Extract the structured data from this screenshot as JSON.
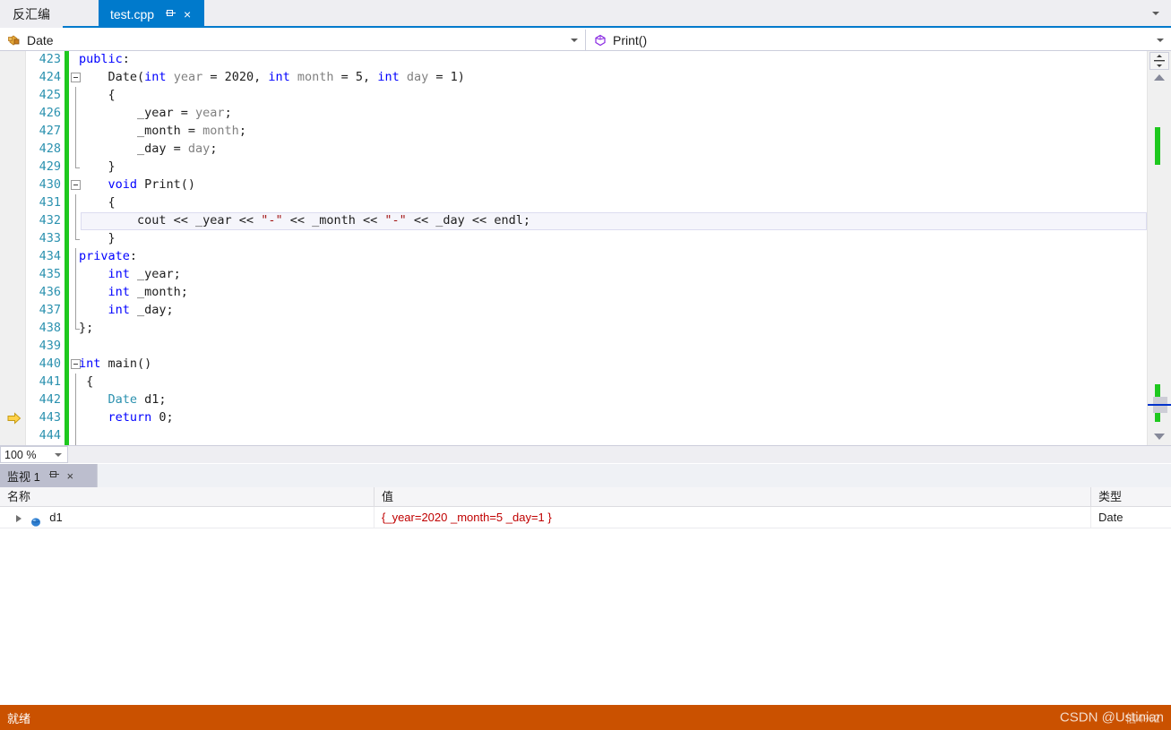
{
  "tabs": {
    "inactive_tab": "反汇编",
    "active_tab": "test.cpp",
    "pin_icon": "pin-icon",
    "close_icon": "×",
    "dropdown_icon": "chevron-down-icon"
  },
  "navbar": {
    "scope_icon": "class-icon",
    "scope": "Date",
    "member_icon": "method-icon",
    "member": "Print()"
  },
  "editor": {
    "zoom_level": "100 %",
    "current_line": 443,
    "lines": [
      {
        "num": "423",
        "changed": true,
        "fold": "none",
        "indent": 0,
        "tokens": [
          {
            "t": "public",
            "c": "kw"
          },
          {
            "t": ":",
            "c": ""
          }
        ]
      },
      {
        "num": "424",
        "changed": true,
        "fold": "minus",
        "indent": 0,
        "tokens": [
          {
            "t": "    Date(",
            "c": ""
          },
          {
            "t": "int",
            "c": "kw"
          },
          {
            "t": " ",
            "c": ""
          },
          {
            "t": "year",
            "c": "par"
          },
          {
            "t": " = 2020, ",
            "c": ""
          },
          {
            "t": "int",
            "c": "kw"
          },
          {
            "t": " ",
            "c": ""
          },
          {
            "t": "month",
            "c": "par"
          },
          {
            "t": " = 5, ",
            "c": ""
          },
          {
            "t": "int",
            "c": "kw"
          },
          {
            "t": " ",
            "c": ""
          },
          {
            "t": "day",
            "c": "par"
          },
          {
            "t": " = 1)",
            "c": ""
          }
        ]
      },
      {
        "num": "425",
        "changed": true,
        "fold": "line",
        "indent": 0,
        "tokens": [
          {
            "t": "    {",
            "c": ""
          }
        ]
      },
      {
        "num": "426",
        "changed": true,
        "fold": "line",
        "indent": 0,
        "tokens": [
          {
            "t": "        _year = ",
            "c": ""
          },
          {
            "t": "year",
            "c": "par"
          },
          {
            "t": ";",
            "c": ""
          }
        ]
      },
      {
        "num": "427",
        "changed": true,
        "fold": "line",
        "indent": 0,
        "tokens": [
          {
            "t": "        _month = ",
            "c": ""
          },
          {
            "t": "month",
            "c": "par"
          },
          {
            "t": ";",
            "c": ""
          }
        ]
      },
      {
        "num": "428",
        "changed": true,
        "fold": "line",
        "indent": 0,
        "tokens": [
          {
            "t": "        _day = ",
            "c": ""
          },
          {
            "t": "day",
            "c": "par"
          },
          {
            "t": ";",
            "c": ""
          }
        ]
      },
      {
        "num": "429",
        "changed": true,
        "fold": "end",
        "indent": 0,
        "tokens": [
          {
            "t": "    }",
            "c": ""
          }
        ]
      },
      {
        "num": "430",
        "changed": true,
        "fold": "minus",
        "indent": 0,
        "tokens": [
          {
            "t": "    ",
            "c": ""
          },
          {
            "t": "void",
            "c": "kw"
          },
          {
            "t": " Print()",
            "c": ""
          }
        ]
      },
      {
        "num": "431",
        "changed": true,
        "fold": "line",
        "indent": 0,
        "tokens": [
          {
            "t": "    {",
            "c": ""
          }
        ]
      },
      {
        "num": "432",
        "changed": true,
        "fold": "line",
        "indent": 0,
        "current": true,
        "tokens": [
          {
            "t": "        cout << _year << ",
            "c": ""
          },
          {
            "t": "\"-\"",
            "c": "str"
          },
          {
            "t": " << _month << ",
            "c": ""
          },
          {
            "t": "\"-\"",
            "c": "str"
          },
          {
            "t": " << _day << endl;",
            "c": ""
          }
        ]
      },
      {
        "num": "433",
        "changed": true,
        "fold": "end",
        "indent": 0,
        "tokens": [
          {
            "t": "    }",
            "c": ""
          }
        ]
      },
      {
        "num": "434",
        "changed": true,
        "fold": "line",
        "indent": 0,
        "tokens": [
          {
            "t": "private",
            "c": "kw"
          },
          {
            "t": ":",
            "c": ""
          }
        ]
      },
      {
        "num": "435",
        "changed": true,
        "fold": "line",
        "indent": 0,
        "tokens": [
          {
            "t": "    ",
            "c": ""
          },
          {
            "t": "int",
            "c": "kw"
          },
          {
            "t": " _year;",
            "c": ""
          }
        ]
      },
      {
        "num": "436",
        "changed": true,
        "fold": "line",
        "indent": 0,
        "tokens": [
          {
            "t": "    ",
            "c": ""
          },
          {
            "t": "int",
            "c": "kw"
          },
          {
            "t": " _month;",
            "c": ""
          }
        ]
      },
      {
        "num": "437",
        "changed": true,
        "fold": "line",
        "indent": 0,
        "tokens": [
          {
            "t": "    ",
            "c": ""
          },
          {
            "t": "int",
            "c": "kw"
          },
          {
            "t": " _day;",
            "c": ""
          }
        ]
      },
      {
        "num": "438",
        "changed": true,
        "fold": "end",
        "indent": 0,
        "tokens": [
          {
            "t": "};",
            "c": ""
          }
        ]
      },
      {
        "num": "439",
        "changed": true,
        "fold": "none",
        "indent": 0,
        "tokens": [
          {
            "t": "",
            "c": ""
          }
        ]
      },
      {
        "num": "440",
        "changed": true,
        "fold": "minus",
        "indent": 0,
        "tokens": [
          {
            "t": "int",
            "c": "kw"
          },
          {
            "t": " main()",
            "c": ""
          }
        ]
      },
      {
        "num": "441",
        "changed": true,
        "fold": "line",
        "indent": 0,
        "tokens": [
          {
            "t": " {",
            "c": ""
          }
        ]
      },
      {
        "num": "442",
        "changed": true,
        "fold": "line",
        "indent": 0,
        "tokens": [
          {
            "t": "    ",
            "c": ""
          },
          {
            "t": "Date",
            "c": "typ"
          },
          {
            "t": " d1;",
            "c": ""
          }
        ]
      },
      {
        "num": "443",
        "changed": true,
        "fold": "line",
        "indent": 0,
        "arrow": true,
        "tokens": [
          {
            "t": "    ",
            "c": ""
          },
          {
            "t": "return",
            "c": "kw"
          },
          {
            "t": " 0;",
            "c": ""
          }
        ]
      },
      {
        "num": "444",
        "changed": true,
        "fold": "line",
        "indent": 0,
        "tokens": [
          {
            "t": "",
            "c": ""
          }
        ]
      }
    ]
  },
  "watch": {
    "panel_title": "监视 1",
    "pin_icon": "pin-icon",
    "close_icon": "×",
    "columns": [
      "名称",
      "值",
      "类型"
    ],
    "rows": [
      {
        "expander_icon": "chevron-right-icon",
        "value_icon": "object-icon",
        "name": "d1",
        "value": "{_year=2020 _month=5 _day=1 }",
        "type": "Date"
      }
    ]
  },
  "statusbar": {
    "status": "就绪",
    "watermark": "CSDN @Ustinian",
    "watermark_overlay": "信4%2"
  },
  "colors": {
    "accent": "#007acc",
    "status_bar": "#ca5100",
    "keyword": "#0000ff",
    "type": "#2b91af",
    "string": "#a31515",
    "parameter": "#808080",
    "linenumber": "#2b91af",
    "changebar": "#1ec81e",
    "watch_value": "#c00000"
  }
}
